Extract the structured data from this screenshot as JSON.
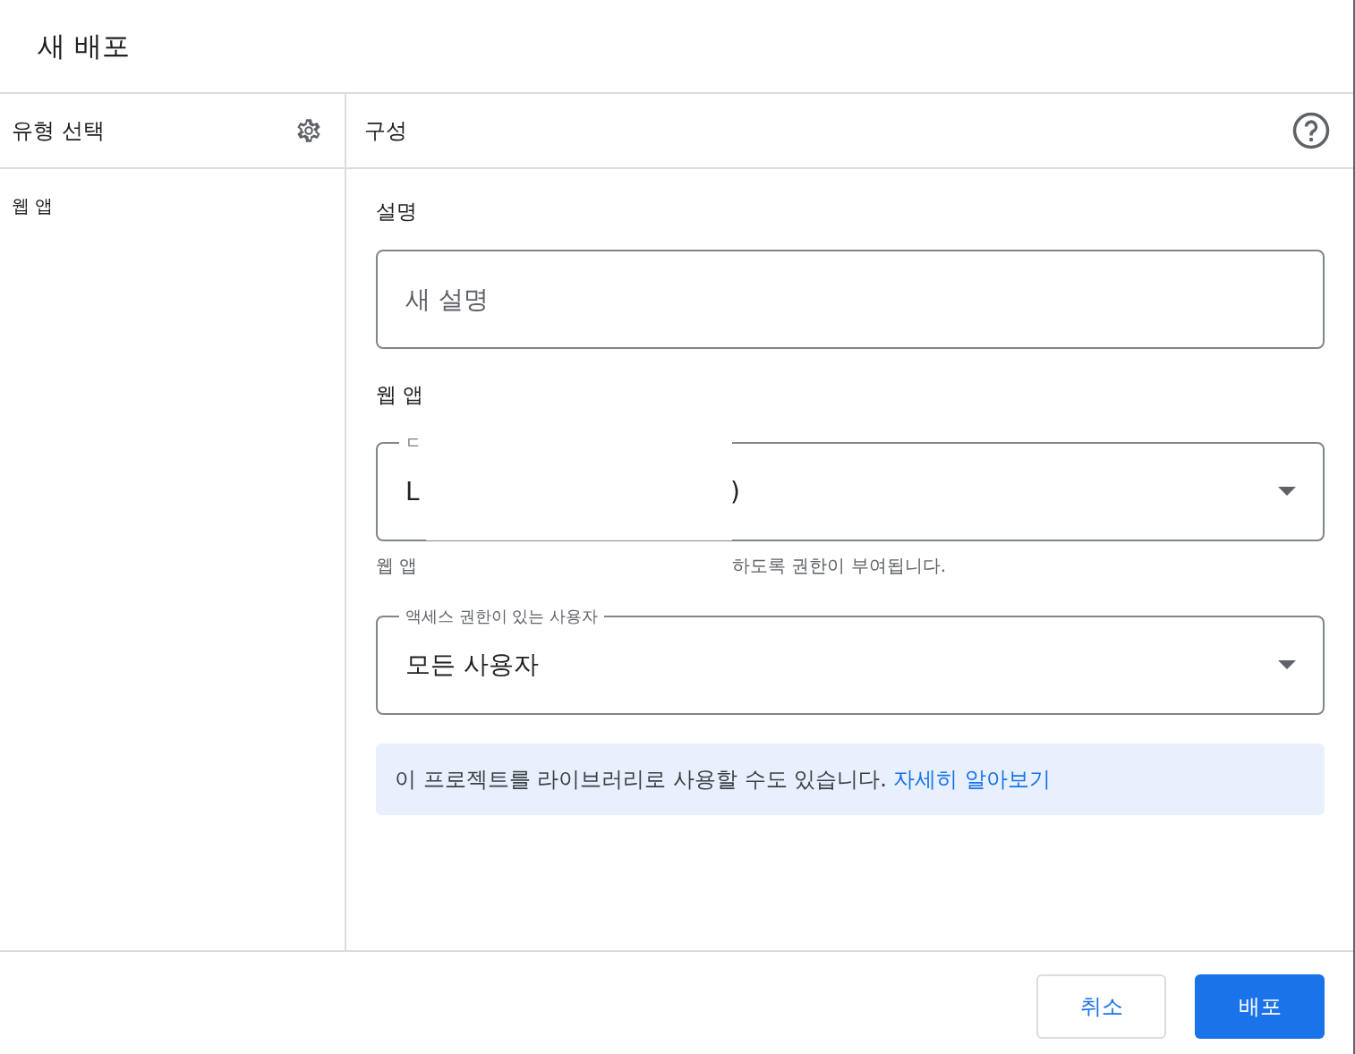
{
  "dialog": {
    "title": "새 배포"
  },
  "type_panel": {
    "title": "유형 선택",
    "items": [
      {
        "label": "웹 앱"
      }
    ]
  },
  "config_panel": {
    "title": "구성",
    "description": {
      "heading": "설명",
      "placeholder": "새 설명"
    },
    "web_app": {
      "heading": "웹 앱",
      "execute_as": {
        "label": "ㄷ",
        "value_start": "L",
        "value_end": ")",
        "helper_start": "웹 앱",
        "helper_end": "하도록 권한이 부여됩니다."
      },
      "access": {
        "label": "액세스 권한이 있는 사용자",
        "value": "모든 사용자"
      }
    },
    "info": {
      "text": "이 프로젝트를 라이브러리로 사용할 수도 있습니다.",
      "link": "자세히 알아보기"
    }
  },
  "buttons": [
    {
      "label": "취소",
      "kind": "secondary"
    },
    {
      "label": "배포",
      "kind": "primary"
    }
  ]
}
